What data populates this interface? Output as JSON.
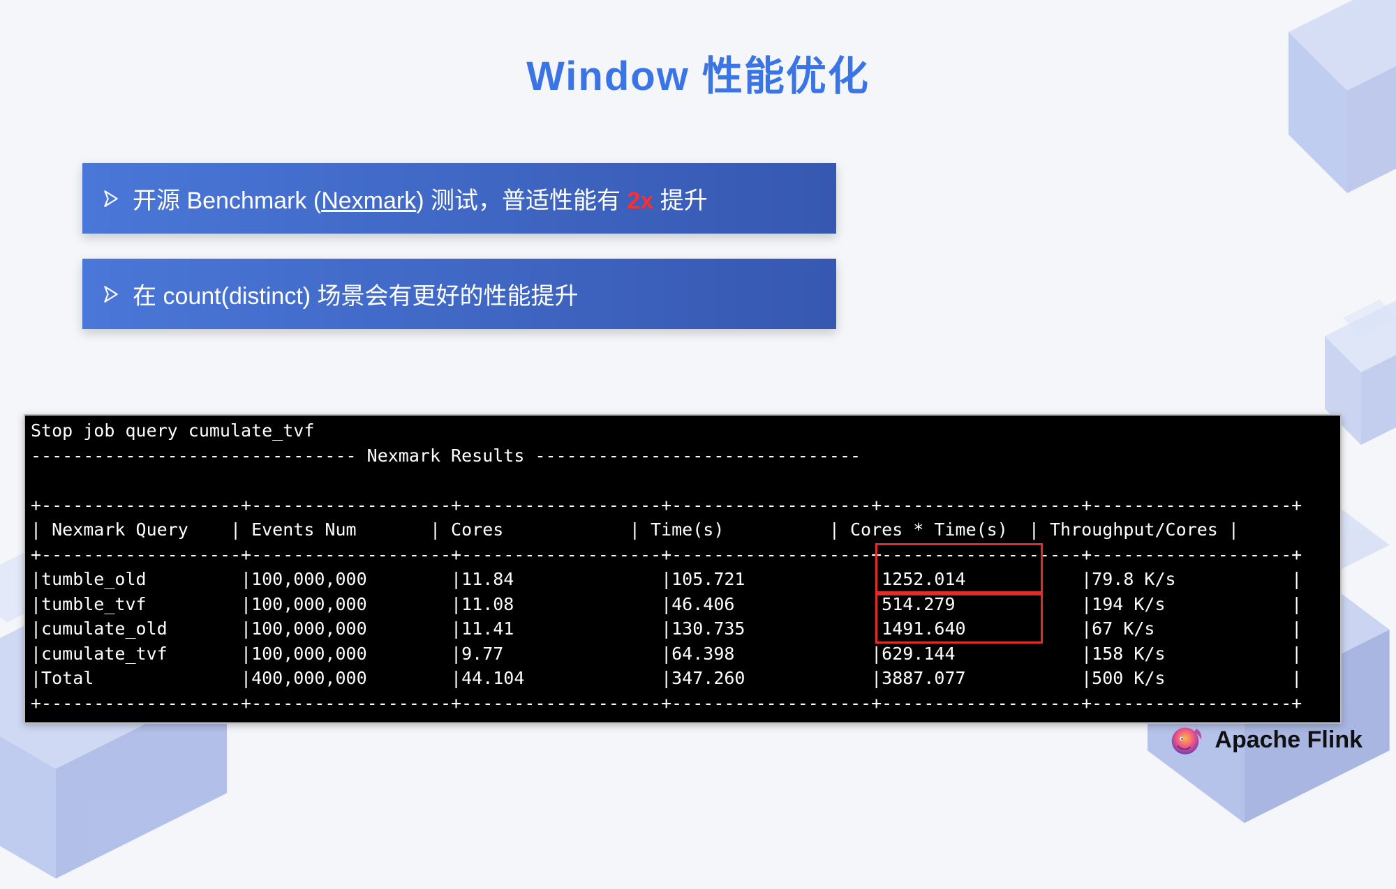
{
  "title": "Window 性能优化",
  "bullet1": {
    "pre": "开源 Benchmark (",
    "link": "Nexmark",
    "post": ") 测试，普适性能有 ",
    "hl": "2x",
    "tail": " 提升"
  },
  "bullet2": "在 count(distinct) 场景会有更好的性能提升",
  "term": {
    "l0": "Stop job query cumulate_tvf",
    "l1": "------------------------------- Nexmark Results -------------------------------",
    "blank": "",
    "sep": "+-------------------+-------------------+-------------------+-------------------+-------------------+-------------------+",
    "hdr": [
      "Nexmark Query",
      "Events Num",
      "Cores",
      "Time(s)",
      "Cores * Time(s)",
      "Throughput/Cores"
    ],
    "rows": [
      [
        "tumble_old",
        "100,000,000",
        "11.84",
        "105.721",
        "1252.014",
        "79.8 K/s"
      ],
      [
        "tumble_tvf",
        "100,000,000",
        "11.08",
        "46.406",
        "514.279",
        "194 K/s"
      ],
      [
        "cumulate_old",
        "100,000,000",
        "11.41",
        "130.735",
        "1491.640",
        "67 K/s"
      ],
      [
        "cumulate_tvf",
        "100,000,000",
        "9.77",
        "64.398",
        "629.144",
        "158 K/s"
      ],
      [
        "Total",
        "400,000,000",
        "44.104",
        "347.260",
        "3887.077",
        "500 K/s"
      ]
    ]
  },
  "logo": "Apache Flink",
  "chart_data": {
    "type": "table",
    "title": "Nexmark Results",
    "columns": [
      "Nexmark Query",
      "Events Num",
      "Cores",
      "Time(s)",
      "Cores * Time(s)",
      "Throughput/Cores"
    ],
    "rows": [
      {
        "Nexmark Query": "tumble_old",
        "Events Num": 100000000,
        "Cores": 11.84,
        "Time(s)": 105.721,
        "Cores * Time(s)": 1252.014,
        "Throughput/Cores": "79.8 K/s"
      },
      {
        "Nexmark Query": "tumble_tvf",
        "Events Num": 100000000,
        "Cores": 11.08,
        "Time(s)": 46.406,
        "Cores * Time(s)": 514.279,
        "Throughput/Cores": "194 K/s"
      },
      {
        "Nexmark Query": "cumulate_old",
        "Events Num": 100000000,
        "Cores": 11.41,
        "Time(s)": 130.735,
        "Cores * Time(s)": 1491.64,
        "Throughput/Cores": "67 K/s"
      },
      {
        "Nexmark Query": "cumulate_tvf",
        "Events Num": 100000000,
        "Cores": 9.77,
        "Time(s)": 64.398,
        "Cores * Time(s)": 629.144,
        "Throughput/Cores": "158 K/s"
      },
      {
        "Nexmark Query": "Total",
        "Events Num": 400000000,
        "Cores": 44.104,
        "Time(s)": 347.26,
        "Cores * Time(s)": 3887.077,
        "Throughput/Cores": "500 K/s"
      }
    ],
    "highlighted_cells": [
      {
        "row": 0,
        "col": "Cores * Time(s)"
      },
      {
        "row": 1,
        "col": "Cores * Time(s)"
      },
      {
        "row": 2,
        "col": "Cores * Time(s)"
      },
      {
        "row": 3,
        "col": "Cores * Time(s)"
      }
    ]
  }
}
